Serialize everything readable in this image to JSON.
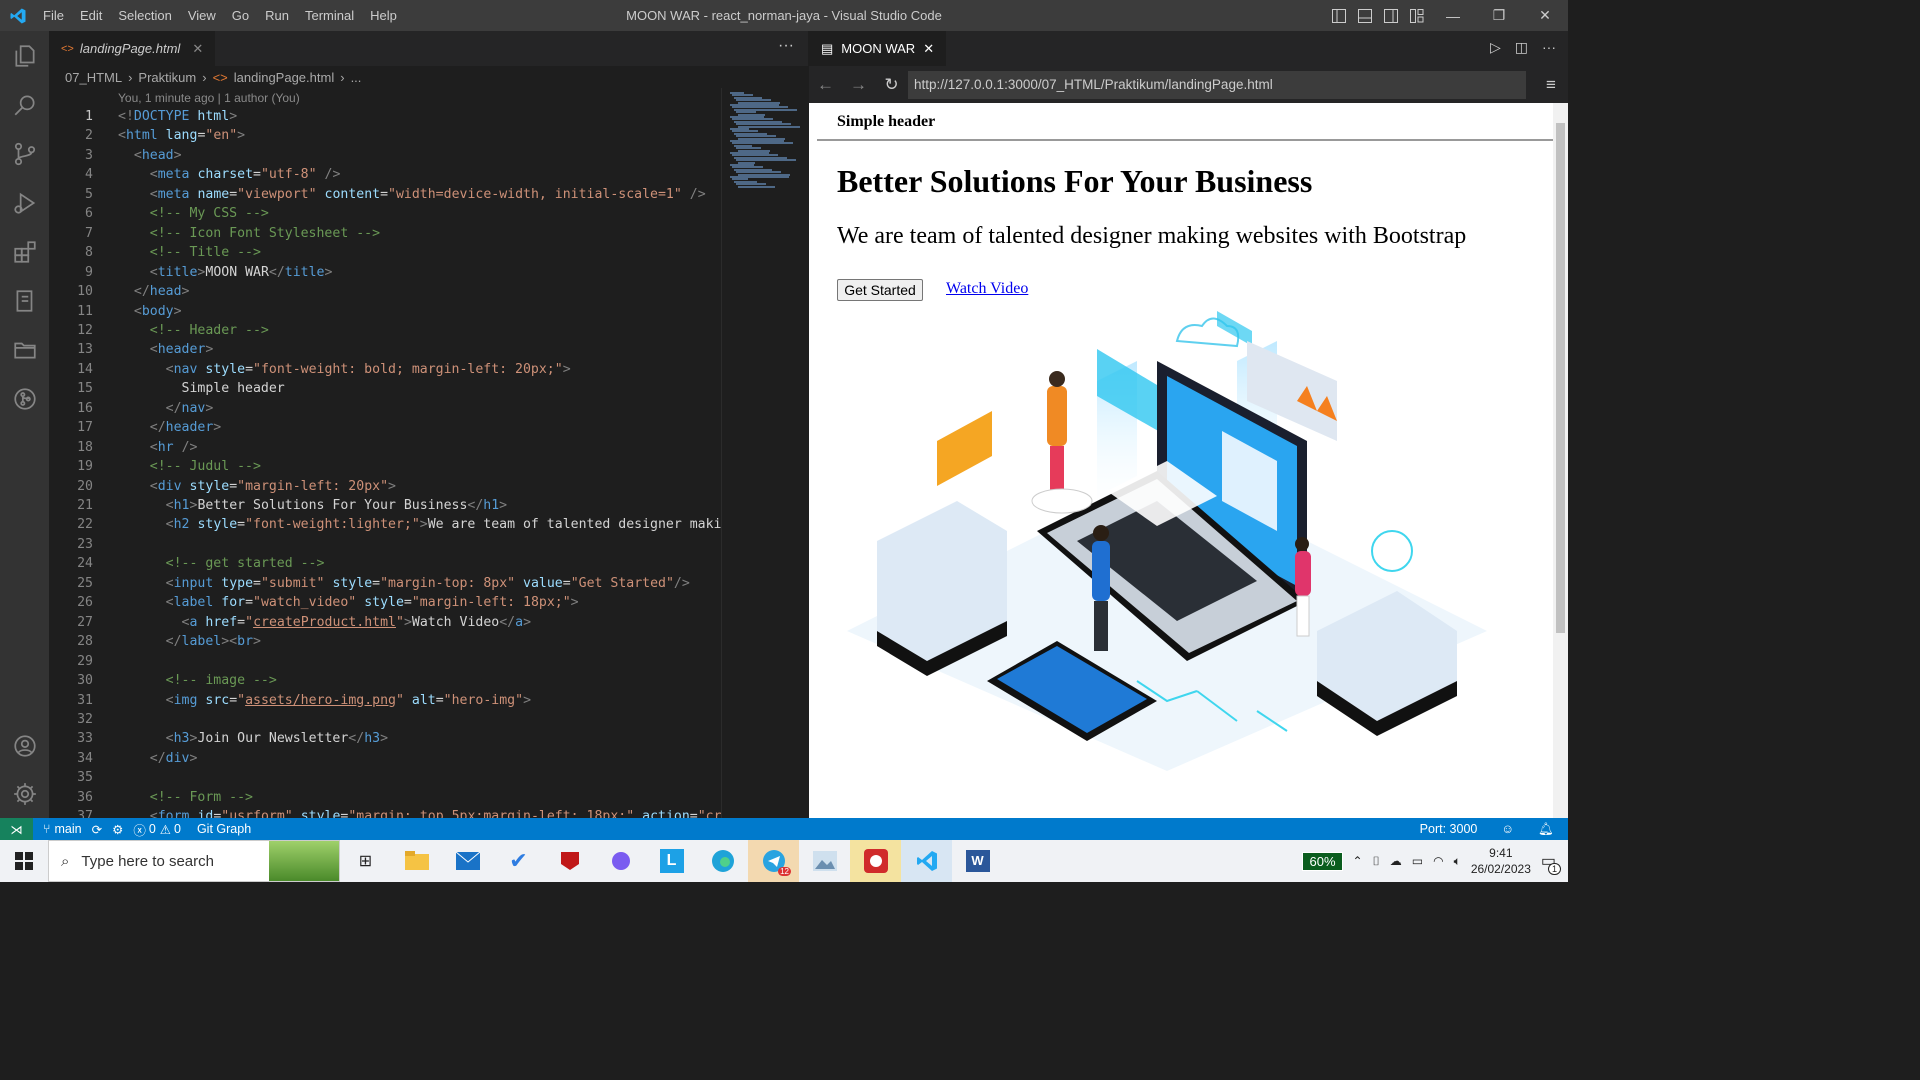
{
  "window": {
    "title": "MOON WAR - react_norman-jaya - Visual Studio Code"
  },
  "menu": [
    "File",
    "Edit",
    "Selection",
    "View",
    "Go",
    "Run",
    "Terminal",
    "Help"
  ],
  "editor": {
    "tab_label": "landingPage.html",
    "breadcrumb": [
      "07_HTML",
      "Praktikum",
      "landingPage.html",
      "..."
    ],
    "blame": "You, 1 minute ago | 1 author (You)"
  },
  "code_lines": [
    {
      "n": "1"
    },
    {
      "n": "2"
    },
    {
      "n": "3"
    },
    {
      "n": "4"
    },
    {
      "n": "5"
    },
    {
      "n": "6"
    },
    {
      "n": "7"
    },
    {
      "n": "8"
    },
    {
      "n": "9"
    },
    {
      "n": "10"
    },
    {
      "n": "11"
    },
    {
      "n": "12"
    },
    {
      "n": "13"
    },
    {
      "n": "14"
    },
    {
      "n": "15"
    },
    {
      "n": "16"
    },
    {
      "n": "17"
    },
    {
      "n": "18"
    },
    {
      "n": "19"
    },
    {
      "n": "20"
    },
    {
      "n": "21"
    },
    {
      "n": "22"
    },
    {
      "n": "23"
    },
    {
      "n": "24"
    },
    {
      "n": "25"
    },
    {
      "n": "26"
    },
    {
      "n": "27"
    },
    {
      "n": "28"
    },
    {
      "n": "29"
    },
    {
      "n": "30"
    },
    {
      "n": "31"
    },
    {
      "n": "32"
    },
    {
      "n": "33"
    },
    {
      "n": "34"
    },
    {
      "n": "35"
    },
    {
      "n": "36"
    },
    {
      "n": "37"
    }
  ],
  "preview": {
    "tab_label": "MOON WAR",
    "url": "http://127.0.0.1:3000/07_HTML/Praktikum/landingPage.html",
    "simple_header": "Simple header",
    "h1": "Better Solutions For Your Business",
    "h2": "We are team of talented designer making websites with Bootstrap",
    "button": "Get Started",
    "link": "Watch Video"
  },
  "status": {
    "branch": "main",
    "errors": "0",
    "warnings": "0",
    "git_graph": "Git Graph",
    "port": "Port: 3000"
  },
  "taskbar": {
    "search_placeholder": "Type here to search",
    "battery": "60%",
    "time": "9:41",
    "date": "26/02/2023",
    "telegram_badge": "12",
    "notif_count": "1"
  }
}
